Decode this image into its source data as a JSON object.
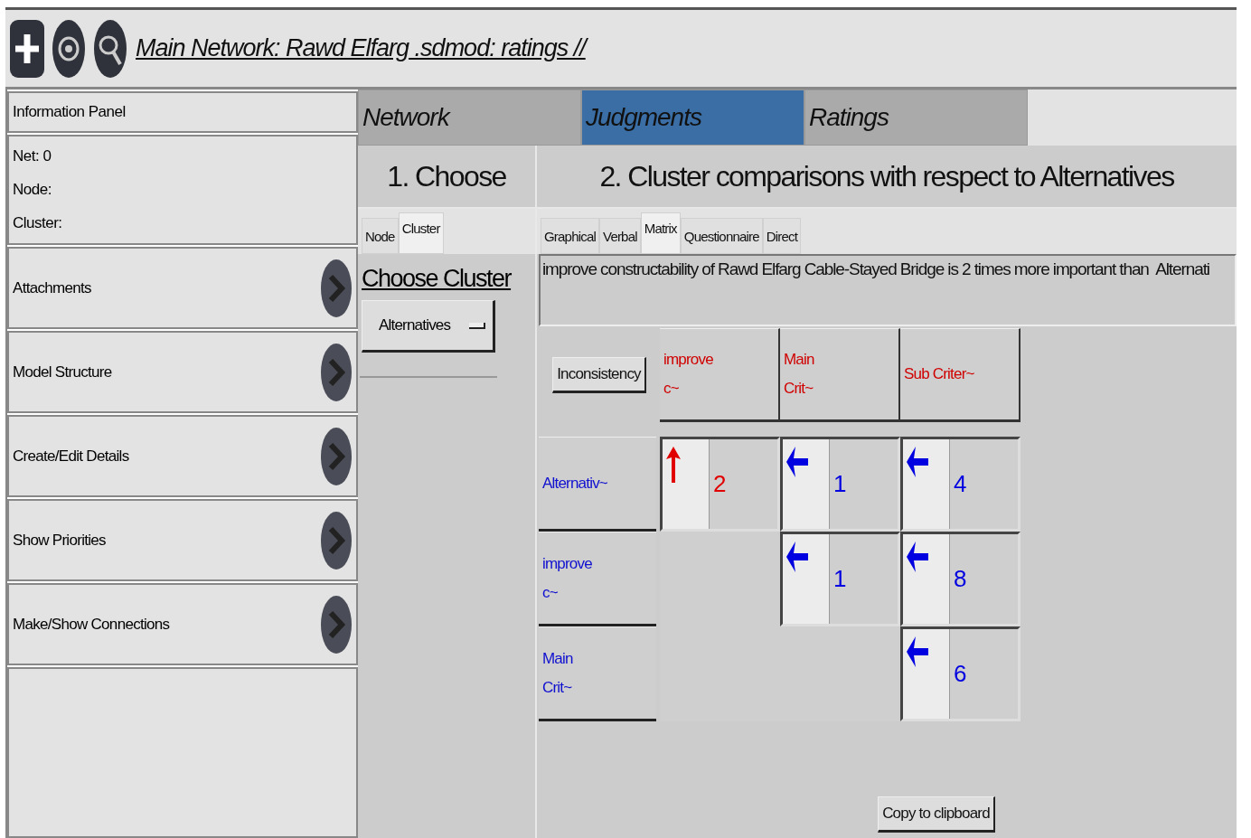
{
  "title": "Main Network: Rawd Elfarg .sdmod: ratings //",
  "info_panel": {
    "header": "Information Panel",
    "lines": [
      "Net: 0",
      "Node:",
      "Cluster:"
    ]
  },
  "menu": [
    "Attachments",
    "Model Structure",
    "Create/Edit Details",
    "Show Priorities",
    "Make/Show Connections"
  ],
  "tabs": [
    {
      "label": "Network",
      "selected": false
    },
    {
      "label": "Judgments",
      "selected": true
    },
    {
      "label": "Ratings",
      "selected": false
    }
  ],
  "choose": {
    "heading": "1. Choose",
    "tabs": [
      {
        "label": "Node",
        "selected": false
      },
      {
        "label": "Cluster",
        "selected": true
      }
    ],
    "title": "Choose Cluster",
    "dropdown": "Alternatives"
  },
  "comparison": {
    "heading": "2. Cluster comparisons with respect to Alternatives",
    "tabs": [
      {
        "label": "Graphical",
        "selected": false
      },
      {
        "label": "Verbal",
        "selected": false
      },
      {
        "label": "Matrix",
        "selected": true
      },
      {
        "label": "Questionnaire",
        "selected": false
      },
      {
        "label": "Direct",
        "selected": false
      }
    ],
    "statement": "improve constructability of Rawd Elfarg Cable-Stayed Bridge is 2 times more important than  Alternati",
    "inconsistency_button": "Inconsistency",
    "columns": [
      "improve\nc~",
      "Main\nCrit~",
      "Sub Criter~"
    ],
    "rows": [
      {
        "label": "Alternativ~",
        "cells": [
          {
            "kind": "up",
            "color": "#e00000",
            "value": "2"
          },
          {
            "kind": "left",
            "color": "#0000e0",
            "value": "1"
          },
          {
            "kind": "left",
            "color": "#0000e0",
            "value": "4"
          }
        ]
      },
      {
        "label": "improve\nc~",
        "cells": [
          "",
          {
            "kind": "left",
            "color": "#0000e0",
            "value": "1"
          },
          {
            "kind": "left",
            "color": "#0000e0",
            "value": "8"
          }
        ]
      },
      {
        "label": "Main\nCrit~",
        "cells": [
          "",
          "",
          {
            "kind": "left",
            "color": "#0000e0",
            "value": "6"
          }
        ]
      }
    ],
    "copy_button": "Copy to clipboard"
  }
}
